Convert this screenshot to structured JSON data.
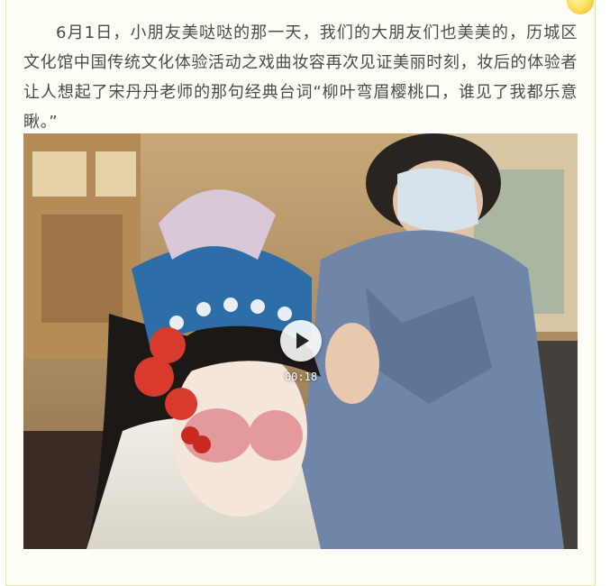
{
  "article": {
    "paragraph": "6月1日，小朋友美哒哒的那一天，我们的大朋友们也美美的，历城区文化馆中国传统文化体验活动之戏曲妆容再次见证美丽时刻，妆后的体验者让人想起了宋丹丹老师的那句经典台词“柳叶弯眉樱桃口，谁见了我都乐意瞅。”"
  },
  "video": {
    "duration": "00:18",
    "play_icon": "play-icon",
    "thumbnail_description_icon": "video-thumbnail"
  },
  "colors": {
    "card_background": "#fffef6",
    "card_border": "#ece2b0",
    "text": "#4a4a4a",
    "decoration": "#f6d94a"
  }
}
